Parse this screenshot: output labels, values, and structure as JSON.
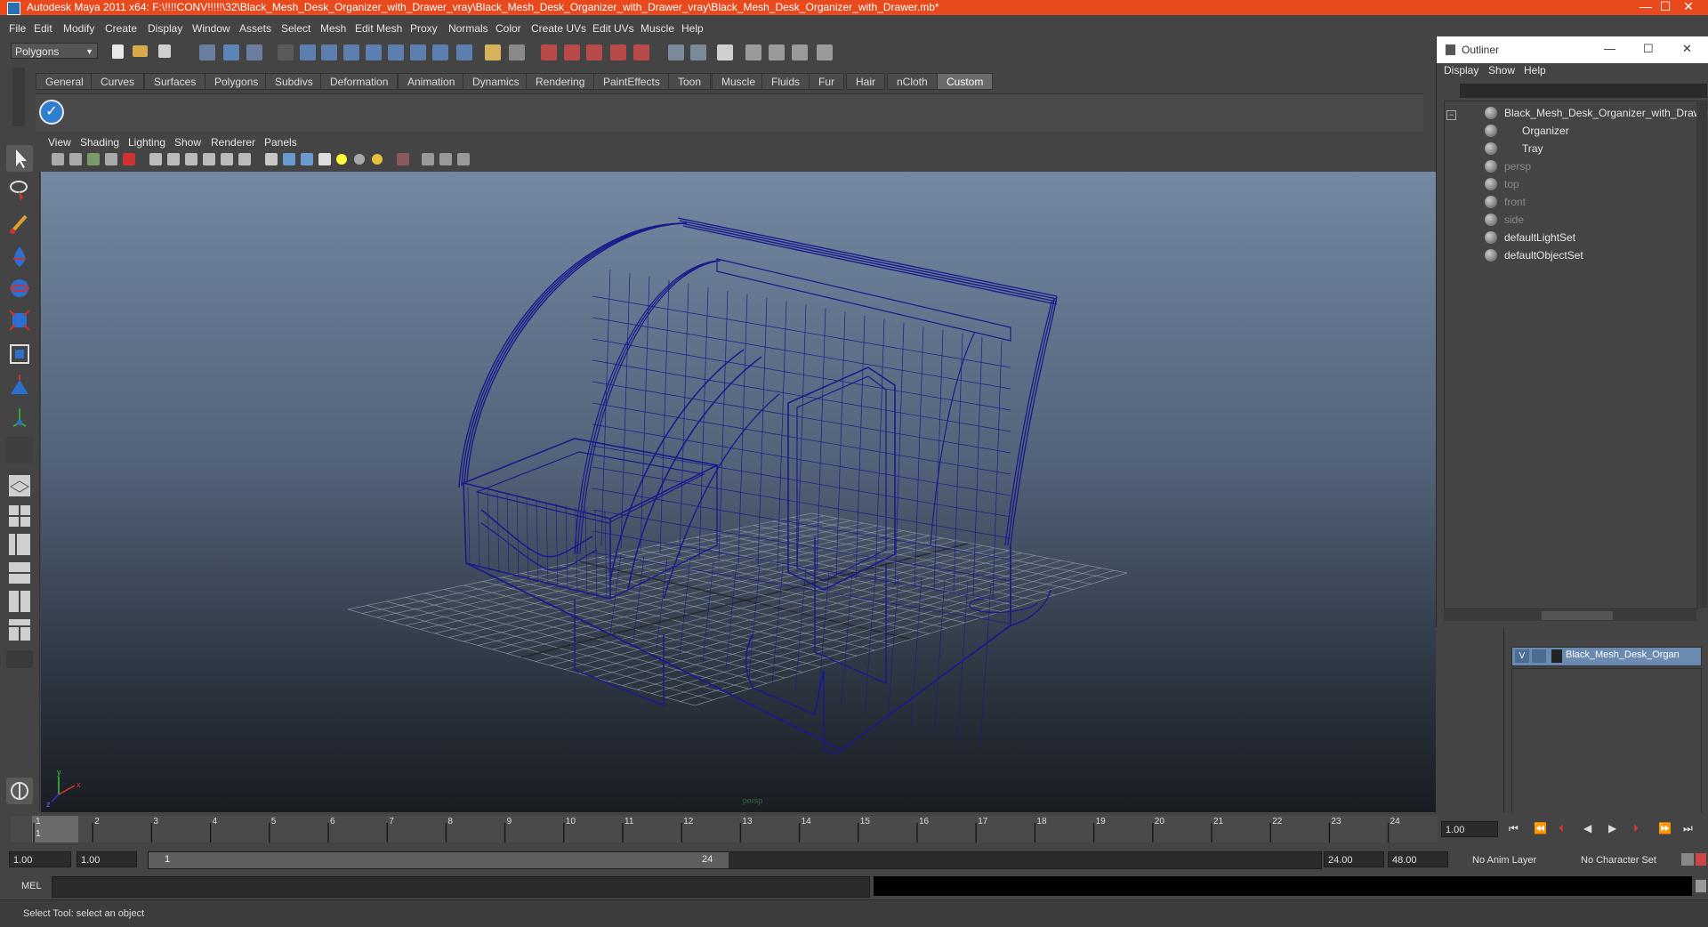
{
  "window": {
    "title": "Autodesk Maya 2011 x64: F:\\!!!!CONV!!!!!\\32\\Black_Mesh_Desk_Organizer_with_Drawer_vray\\Black_Mesh_Desk_Organizer_with_Drawer_vray\\Black_Mesh_Desk_Organizer_with_Drawer.mb*",
    "minimize": "—",
    "maximize": "☐",
    "close": "✕"
  },
  "menus": [
    "File",
    "Edit",
    "Modify",
    "Create",
    "Display",
    "Window",
    "Assets",
    "Select",
    "Mesh",
    "Edit Mesh",
    "Proxy",
    "Normals",
    "Color",
    "Create UVs",
    "Edit UVs",
    "Muscle",
    "Help"
  ],
  "status_line": {
    "mode": "Polygons"
  },
  "shelf": {
    "tabs": [
      "General",
      "Curves",
      "Surfaces",
      "Polygons",
      "Subdivs",
      "Deformation",
      "Animation",
      "Dynamics",
      "Rendering",
      "PaintEffects",
      "Toon",
      "Muscle",
      "Fluids",
      "Fur",
      "Hair",
      "nCloth",
      "Custom"
    ],
    "active_tab": "Custom"
  },
  "viewport": {
    "menus": [
      "View",
      "Shading",
      "Lighting",
      "Show",
      "Renderer",
      "Panels"
    ],
    "camera_label": "persp",
    "axis": {
      "x": "x",
      "y": "y",
      "z": "z"
    },
    "wire_color": "#1a1a8c",
    "grid_color": "#9aa3ad"
  },
  "outliner": {
    "title": "Outliner",
    "menus": [
      "Display",
      "Show",
      "Help"
    ],
    "items": [
      {
        "label": "Black_Mesh_Desk_Organizer_with_Drawer",
        "dim": false,
        "indent": 0
      },
      {
        "label": "Organizer",
        "dim": false,
        "indent": 1
      },
      {
        "label": "Tray",
        "dim": false,
        "indent": 1
      },
      {
        "label": "persp",
        "dim": true,
        "indent": 0
      },
      {
        "label": "top",
        "dim": true,
        "indent": 0
      },
      {
        "label": "front",
        "dim": true,
        "indent": 0
      },
      {
        "label": "side",
        "dim": true,
        "indent": 0
      },
      {
        "label": "defaultLightSet",
        "dim": false,
        "indent": 0
      },
      {
        "label": "defaultObjectSet",
        "dim": false,
        "indent": 0
      }
    ]
  },
  "layers": {
    "items": [
      {
        "visible": "V",
        "name": "Black_Mesh_Desk_Organ"
      }
    ]
  },
  "time_slider": {
    "ticks": [
      "1",
      "2",
      "3",
      "4",
      "5",
      "6",
      "7",
      "8",
      "9",
      "10",
      "11",
      "12",
      "13",
      "14",
      "15",
      "16",
      "17",
      "18",
      "19",
      "20",
      "21",
      "22",
      "23",
      "24"
    ],
    "current_frame": "1",
    "current_time": "1.00"
  },
  "range_slider": {
    "start_time": "1.00",
    "playback_start": "1.00",
    "range_start_label": "1",
    "range_end_label": "24",
    "playback_end": "24.00",
    "end_time": "48.00",
    "anim_layer": "No Anim Layer",
    "character_set": "No Character Set"
  },
  "command_line": {
    "label": "MEL"
  },
  "help_line": {
    "text": "Select Tool: select an object"
  }
}
